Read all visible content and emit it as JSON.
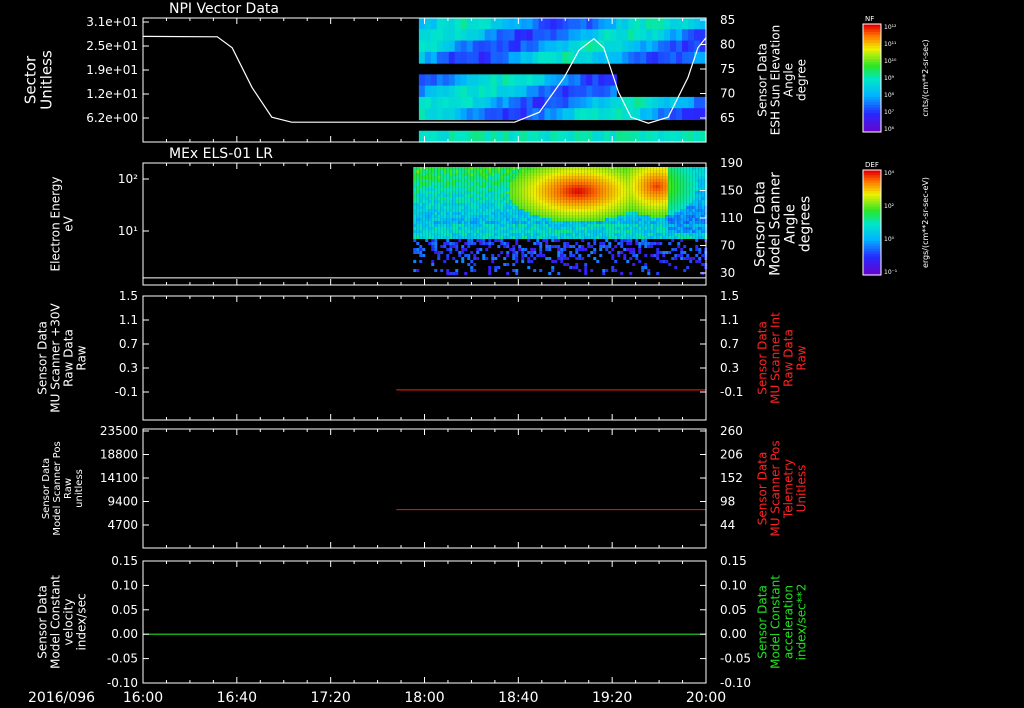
{
  "chart_data": [
    {
      "type": "heatmap",
      "title": "NPI Vector Data",
      "ylabel_left": [
        "Sector",
        "Unitless"
      ],
      "ylabel_right": [
        "Sensor Data",
        "ESH Sun Elevation",
        "Angle",
        "degree"
      ],
      "yticks_left": [
        "3.1e+01",
        "2.5e+01",
        "1.9e+01",
        "1.2e+01",
        "6.2e+00"
      ],
      "yticks_right": [
        "85",
        "80",
        "75",
        "70",
        "65"
      ],
      "ylim_right": [
        60,
        85
      ],
      "colorbar": {
        "label": "NF",
        "unit": "cnts/(cm**2-sr-sec)",
        "ticks": [
          "10¹²",
          "10¹¹",
          "10¹⁰",
          "10⁹",
          "10⁸",
          "10⁷",
          "10⁶"
        ]
      },
      "line": {
        "name": "ESH Sun Elevation Angle",
        "points": [
          [
            0,
            81.3
          ],
          [
            0.15,
            81.2
          ],
          [
            0.18,
            79
          ],
          [
            0.22,
            71
          ],
          [
            0.26,
            65
          ],
          [
            0.3,
            64
          ],
          [
            0.5,
            64
          ],
          [
            0.75,
            64
          ],
          [
            0.8,
            66
          ],
          [
            0.85,
            73
          ],
          [
            0.88,
            78.5
          ],
          [
            0.91,
            80.8
          ],
          [
            0.93,
            79
          ],
          [
            0.96,
            70
          ],
          [
            0.985,
            65
          ],
          [
            1.02,
            63.8
          ],
          [
            1.06,
            65
          ],
          [
            1.1,
            73
          ],
          [
            1.12,
            79
          ],
          [
            1.14,
            81
          ]
        ]
      },
      "data_start_fraction": 0.49
    },
    {
      "type": "heatmap",
      "title": "MEx ELS-01 LR",
      "ylabel_left": [
        "Electron Energy",
        "eV"
      ],
      "ylabel_right": [
        "Sensor Data",
        "Model Scanner",
        "Angle",
        "degrees"
      ],
      "yticks_left": [
        "10²",
        "10¹"
      ],
      "yticks_right": [
        "190",
        "150",
        "110",
        "70",
        "30"
      ],
      "ylim_right": [
        0,
        190
      ],
      "colorbar": {
        "label": "DEF",
        "unit": "ergs/(cm**2-sr-sec-eV)",
        "ticks": [
          "10⁴",
          "10²",
          "10⁰",
          "10⁻¹"
        ]
      },
      "line": {
        "name": "Model Scanner Angle",
        "value": 11
      },
      "data_start_fraction": 0.48
    },
    {
      "type": "line",
      "ylabel_left": [
        "Sensor Data",
        "MU Scanner +30V",
        "Raw Data",
        "Raw"
      ],
      "ylabel_right": [
        "Sensor Data",
        "MU Scanner Int",
        "Raw Data",
        "Raw"
      ],
      "yticks_left": [
        "1.5",
        "1.1",
        "0.7",
        "0.3",
        "-0.1"
      ],
      "yticks_right": [
        "1.5",
        "1.1",
        "0.7",
        "0.3",
        "-0.1"
      ],
      "ylim": [
        -0.35,
        1.5
      ],
      "series": [
        {
          "name": "MU Scanner Int",
          "color": "#d41414",
          "x_start_fraction": 0.45,
          "value": 0.1
        }
      ]
    },
    {
      "type": "line",
      "ylabel_left": [
        "Sensor Data",
        "Model Scanner Pos",
        "Raw",
        "unitless"
      ],
      "ylabel_right": [
        "Sensor Data",
        "MU Scanner Pos",
        "Telemetry",
        "Unitless"
      ],
      "yticks_left": [
        "23500",
        "18800",
        "14100",
        "9400",
        "4700"
      ],
      "yticks_right": [
        "260",
        "206",
        "152",
        "98",
        "44"
      ],
      "ylim_right": [
        0,
        260
      ],
      "series": [
        {
          "name": "MU Scanner Pos Telemetry",
          "color": "#d41414",
          "x_start_fraction": 0.45,
          "value": 84
        }
      ]
    },
    {
      "type": "line",
      "ylabel_left": [
        "Sensor Data",
        "Model Constant",
        "velocity",
        "index/sec"
      ],
      "ylabel_right": [
        "Sensor Data",
        "Model Constant",
        "acceleration",
        "index/sec**2"
      ],
      "yticks_left": [
        "0.15",
        "0.10",
        "0.05",
        "0.00",
        "-0.05",
        "-0.10"
      ],
      "yticks_right": [
        "0.15",
        "0.10",
        "0.05",
        "0.00",
        "-0.05",
        "-0.10"
      ],
      "ylim": [
        -0.1,
        0.15
      ],
      "series": [
        {
          "name": "Model Constant acceleration",
          "color": "#20e020",
          "x_start_fraction": 0,
          "value": 0.0
        }
      ]
    }
  ],
  "time_axis": {
    "date": "2016/096",
    "ticks": [
      "16:00",
      "16:40",
      "17:20",
      "18:00",
      "18:40",
      "19:20",
      "20:00"
    ]
  },
  "colors": {
    "background": "#000000",
    "frame": "#ffffff",
    "red_axis": "#ff2020",
    "green_axis": "#20e020"
  }
}
